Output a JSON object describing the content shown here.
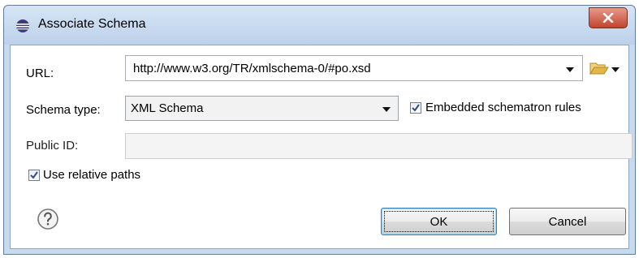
{
  "window": {
    "title": "Associate Schema",
    "icons": {
      "app": "eclipse-icon",
      "close": "close-icon"
    }
  },
  "form": {
    "url": {
      "label": "URL:",
      "value": "http://www.w3.org/TR/xmlschema-0/#po.xsd",
      "icons": [
        "dropdown-caret-icon",
        "folder-open-icon",
        "chevron-down-icon"
      ]
    },
    "schema_type": {
      "label": "Schema type:",
      "selected": "XML Schema"
    },
    "embedded_schematron": {
      "label": "Embedded schematron rules",
      "checked": true
    },
    "public_id": {
      "label": "Public ID:",
      "value": "",
      "disabled": true
    },
    "relative_paths": {
      "label": "Use relative paths",
      "checked": true
    }
  },
  "footer": {
    "help_icon": "help-icon",
    "ok_label": "OK",
    "cancel_label": "Cancel"
  },
  "colors": {
    "frame": "#c8daee",
    "close_button": "#c2432e",
    "checkbox_check": "#2a4f86",
    "folder": "#e2b64a"
  }
}
